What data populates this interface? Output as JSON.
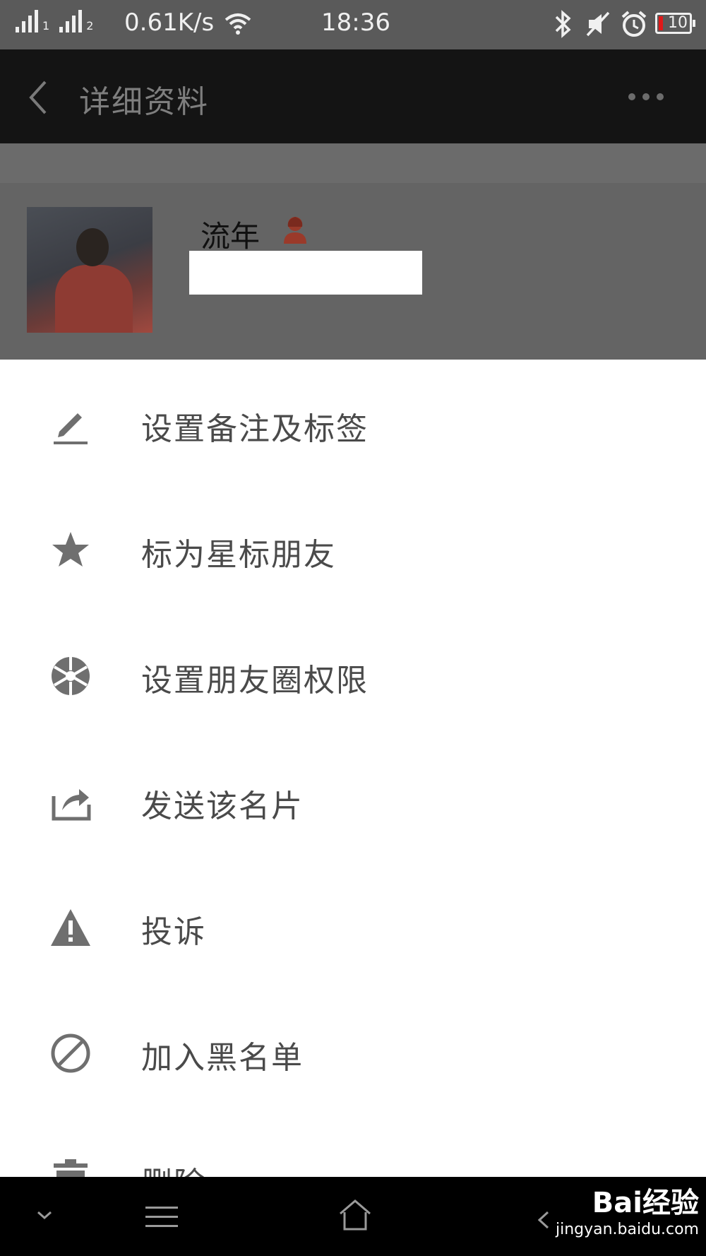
{
  "status_bar": {
    "sim1": "1",
    "sim2": "2",
    "net_speed": "0.61K/s",
    "time": "18:36",
    "battery": "10"
  },
  "header": {
    "title": "详细资料"
  },
  "profile": {
    "nickname": "流年"
  },
  "menu": {
    "items": [
      {
        "label": "设置备注及标签",
        "icon": "edit-pencil-icon"
      },
      {
        "label": "标为星标朋友",
        "icon": "star-icon"
      },
      {
        "label": "设置朋友圈权限",
        "icon": "aperture-icon"
      },
      {
        "label": "发送该名片",
        "icon": "share-icon"
      },
      {
        "label": "投诉",
        "icon": "warning-icon"
      },
      {
        "label": "加入黑名单",
        "icon": "block-icon"
      },
      {
        "label": "删除",
        "icon": "trash-icon"
      }
    ]
  },
  "watermark": {
    "brand": "Bai经验",
    "url": "jingyan.baidu.com"
  },
  "colors": {
    "overlay": "#646464",
    "title_bar": "#141414",
    "menu_text": "#4a4a4a",
    "icon": "#6f6f6f",
    "gender_icon": "#9a3a2a"
  }
}
